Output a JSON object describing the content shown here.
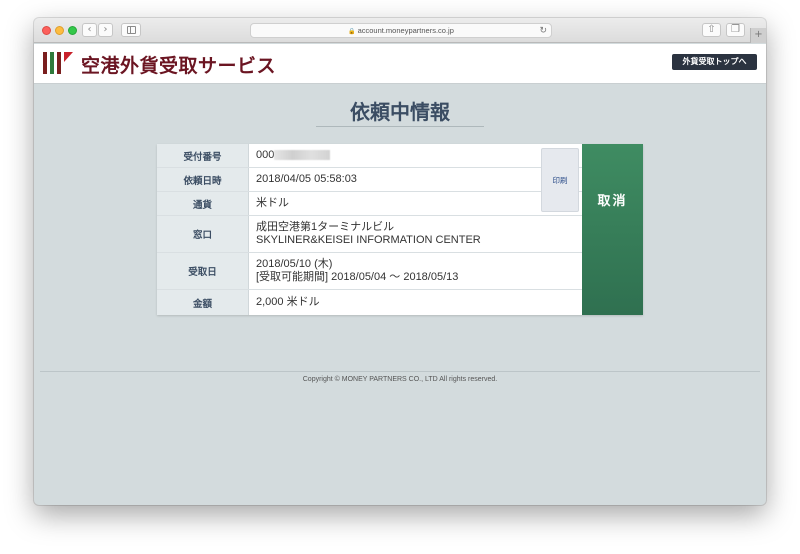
{
  "browser": {
    "url": "account.moneypartners.co.jp"
  },
  "header": {
    "logo_text": "空港外貨受取サービス",
    "top_button_label": "外貨受取トップへ"
  },
  "page": {
    "title": "依頼中情報"
  },
  "request": {
    "rows": [
      {
        "label": "受付番号",
        "value": "000"
      },
      {
        "label": "依頼日時",
        "value": "2018/04/05 05:58:03"
      },
      {
        "label": "通貨",
        "value": "米ドル"
      },
      {
        "label": "窓口",
        "value": "成田空港第1ターミナルビル",
        "value2": "SKYLINER&KEISEI INFORMATION CENTER"
      },
      {
        "label": "受取日",
        "value": "2018/05/10 (木)",
        "value2": "[受取可能期間] 2018/05/04 〜 2018/05/13"
      },
      {
        "label": "金額",
        "value": "2,000 米ドル"
      }
    ],
    "print_label": "印刷",
    "cancel_label": "取消"
  },
  "footer": {
    "copyright": "Copyright © MONEY PARTNERS CO., LTD All rights reserved."
  }
}
